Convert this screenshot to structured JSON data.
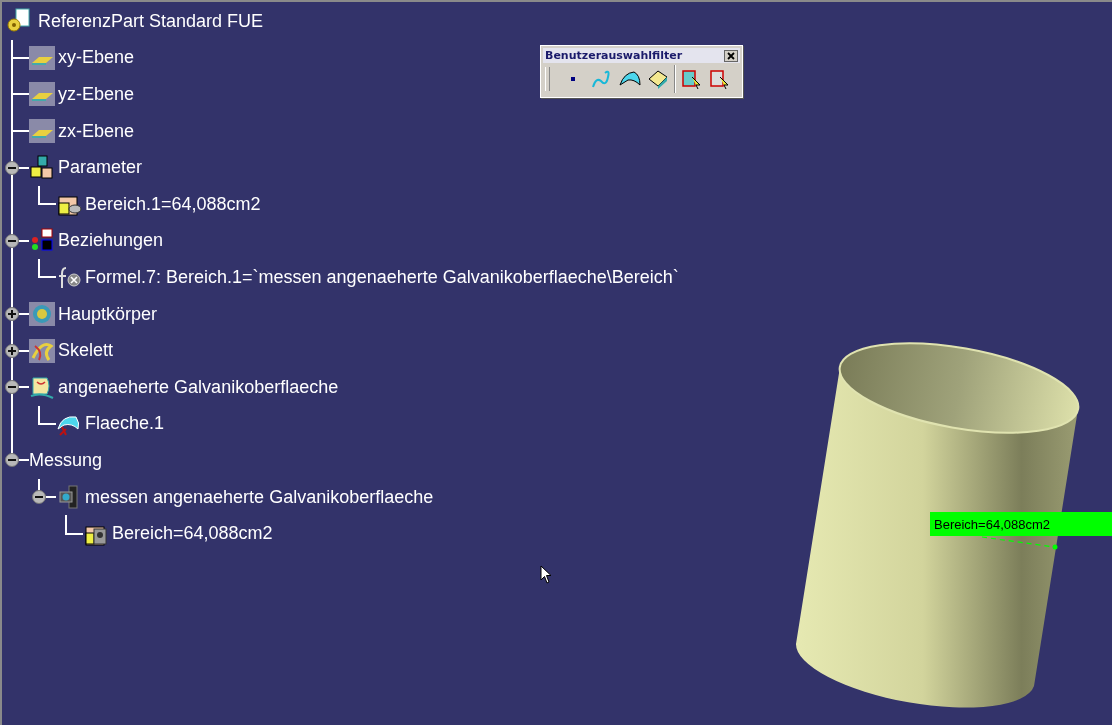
{
  "tree": {
    "label": "ReferenzPart Standard FUE",
    "kind": "part",
    "children": [
      {
        "label": "xy-Ebene",
        "kind": "plane"
      },
      {
        "label": "yz-Ebene",
        "kind": "plane"
      },
      {
        "label": "zx-Ebene",
        "kind": "plane"
      },
      {
        "label": "Parameter",
        "kind": "parameters",
        "expanded": true,
        "children": [
          {
            "label": "Bereich.1=64,088cm2",
            "kind": "parameter"
          }
        ]
      },
      {
        "label": "Beziehungen",
        "kind": "relations",
        "expanded": true,
        "children": [
          {
            "label": "Formel.7: Bereich.1=`messen angenaeherte Galvanikoberflaeche\\Bereich`",
            "kind": "formula"
          }
        ]
      },
      {
        "label": "Hauptkörper",
        "kind": "body",
        "expanded": false
      },
      {
        "label": "Skelett",
        "kind": "skeleton",
        "expanded": false
      },
      {
        "label": "angenaeherte Galvanikoberflaeche",
        "kind": "geoset",
        "expanded": true,
        "children": [
          {
            "label": "Flaeche.1",
            "kind": "surface"
          }
        ]
      },
      {
        "label": "Messung",
        "kind": "measure-set",
        "expanded": true,
        "children": [
          {
            "label": "messen angenaeherte Galvanikoberflaeche",
            "kind": "measure",
            "expanded": true,
            "children": [
              {
                "label": "Bereich=64,088cm2",
                "kind": "measure-value"
              }
            ]
          }
        ]
      }
    ]
  },
  "toolbar": {
    "title": "Benutzerauswahlfilter"
  },
  "annotation": {
    "label": "Bereich=64,088cm2"
  }
}
